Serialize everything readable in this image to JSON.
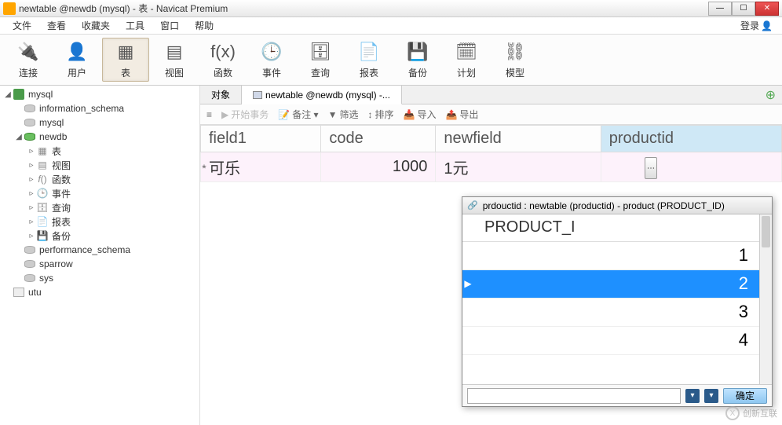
{
  "title": "newtable @newdb (mysql) - 表 - Navicat Premium",
  "menu": {
    "file": "文件",
    "view": "查看",
    "fav": "收藏夹",
    "tool": "工具",
    "window": "窗口",
    "help": "帮助",
    "login": "登录"
  },
  "toolbar": {
    "items": [
      {
        "icon": "plug-icon",
        "glyph": "🔌",
        "label": "连接"
      },
      {
        "icon": "user-icon",
        "glyph": "👤",
        "label": "用户"
      },
      {
        "icon": "table-icon",
        "glyph": "▦",
        "label": "表",
        "active": true
      },
      {
        "icon": "view-icon",
        "glyph": "▤",
        "label": "视图"
      },
      {
        "icon": "fx-icon",
        "glyph": "f(x)",
        "label": "函数"
      },
      {
        "icon": "event-icon",
        "glyph": "🕒",
        "label": "事件"
      },
      {
        "icon": "query-icon",
        "glyph": "🗄",
        "label": "查询"
      },
      {
        "icon": "report-icon",
        "glyph": "📄",
        "label": "报表"
      },
      {
        "icon": "backup-icon",
        "glyph": "💾",
        "label": "备份"
      },
      {
        "icon": "plan-icon",
        "glyph": "🗓",
        "label": "计划"
      },
      {
        "icon": "model-icon",
        "glyph": "⛓",
        "label": "模型"
      }
    ]
  },
  "tree": {
    "conn": "mysql",
    "dbs": [
      {
        "name": "information_schema",
        "open": false
      },
      {
        "name": "mysql",
        "open": false
      },
      {
        "name": "newdb",
        "open": true,
        "children": [
          {
            "name": "表",
            "icon": "table"
          },
          {
            "name": "视图",
            "icon": "view"
          },
          {
            "name": "函数",
            "icon": "fx"
          },
          {
            "name": "事件",
            "icon": "event"
          },
          {
            "name": "查询",
            "icon": "query"
          },
          {
            "name": "报表",
            "icon": "report"
          },
          {
            "name": "备份",
            "icon": "backup"
          }
        ]
      },
      {
        "name": "performance_schema",
        "open": false
      },
      {
        "name": "sparrow",
        "open": false
      },
      {
        "name": "sys",
        "open": false
      }
    ],
    "conn2": "utu"
  },
  "tabs": {
    "obj": "对象",
    "current": "newtable @newdb (mysql) -..."
  },
  "subtool": {
    "begin": "开始事务",
    "memo": "备注 ▾",
    "filter": "筛选",
    "sort": "排序",
    "import": "导入",
    "export": "导出"
  },
  "grid": {
    "cols": [
      "field1",
      "code",
      "newfield",
      "productid"
    ],
    "rows": [
      {
        "field1": "可乐",
        "code": "1000",
        "newfield": "1元",
        "productid": ""
      }
    ]
  },
  "popup": {
    "title": "prdouctid  : newtable (productid) - product (PRODUCT_ID)",
    "header": "PRODUCT_I",
    "values": [
      "1",
      "2",
      "3",
      "4"
    ],
    "selected_index": 1,
    "ok": "确定"
  },
  "watermark": "创新互联"
}
